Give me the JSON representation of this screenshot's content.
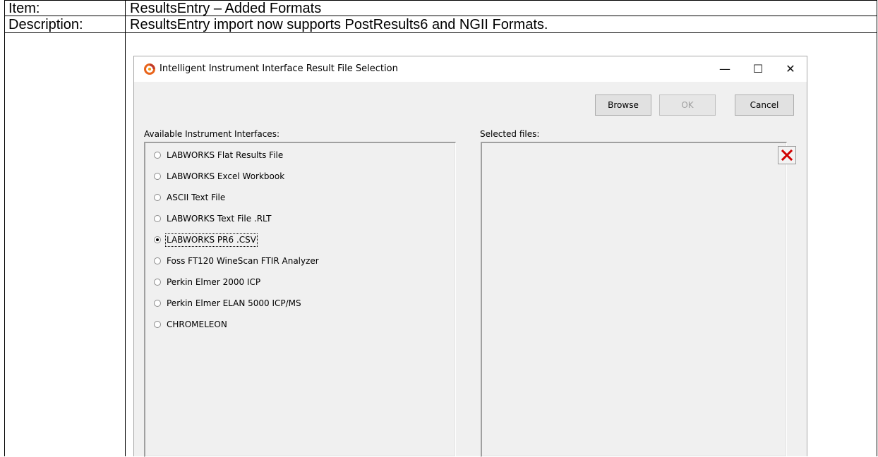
{
  "doc": {
    "row1_label": "Item:",
    "row1_value": "ResultsEntry – Added Formats",
    "row2_label": "Description:",
    "row2_value": "ResultsEntry import now supports PostResults6 and NGII Formats."
  },
  "dialog": {
    "title": "Intelligent Instrument Interface Result File Selection",
    "app_icon": "app-logo-icon",
    "window_controls": {
      "minimize": "—",
      "maximize": "☐",
      "close": "✕"
    },
    "buttons": {
      "browse": "Browse",
      "ok": "OK",
      "cancel": "Cancel"
    },
    "available_label": "Available Instrument Interfaces:",
    "selected_label": "Selected files:",
    "interfaces": [
      {
        "label": "LABWORKS Flat Results File",
        "checked": false
      },
      {
        "label": "LABWORKS Excel Workbook",
        "checked": false
      },
      {
        "label": "ASCII Text File",
        "checked": false
      },
      {
        "label": "LABWORKS Text File  .RLT",
        "checked": false
      },
      {
        "label": "LABWORKS PR6 .CSV",
        "checked": true
      },
      {
        "label": "Foss FT120 WineScan FTIR Analyzer",
        "checked": false
      },
      {
        "label": "Perkin Elmer 2000 ICP",
        "checked": false
      },
      {
        "label": "Perkin Elmer ELAN 5000 ICP/MS",
        "checked": false
      },
      {
        "label": "CHROMELEON",
        "checked": false
      }
    ],
    "delete_icon": "red-x-delete-icon",
    "colors": {
      "delete_x": "#d00000",
      "icon_orange": "#e8641b",
      "dialog_bg": "#f0f0f0"
    }
  }
}
